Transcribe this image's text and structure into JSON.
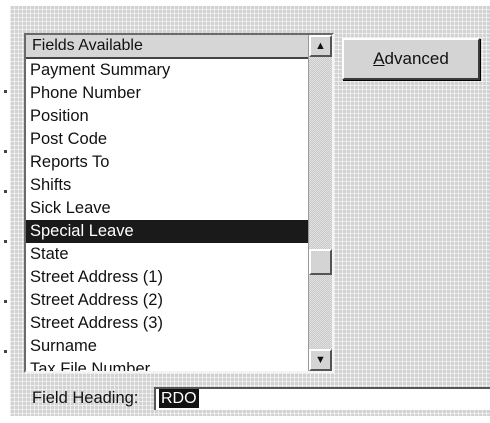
{
  "list": {
    "header": "Fields Available",
    "items": [
      "Payment Summary",
      "Phone Number",
      "Position",
      "Post Code",
      "Reports To",
      "Shifts",
      "Sick Leave",
      "Special Leave",
      "State",
      "Street Address (1)",
      "Street Address (2)",
      "Street Address (3)",
      "Surname",
      "Tax File Number"
    ],
    "selected": "Special Leave"
  },
  "scrollbar": {
    "up_icon": "arrow-up-icon",
    "down_icon": "arrow-down-icon",
    "up_glyph": "▲",
    "down_glyph": "▼"
  },
  "advanced_button": {
    "accel": "A",
    "rest": "dvanced"
  },
  "field_heading": {
    "label": "Field Heading:",
    "value": "RDO"
  }
}
